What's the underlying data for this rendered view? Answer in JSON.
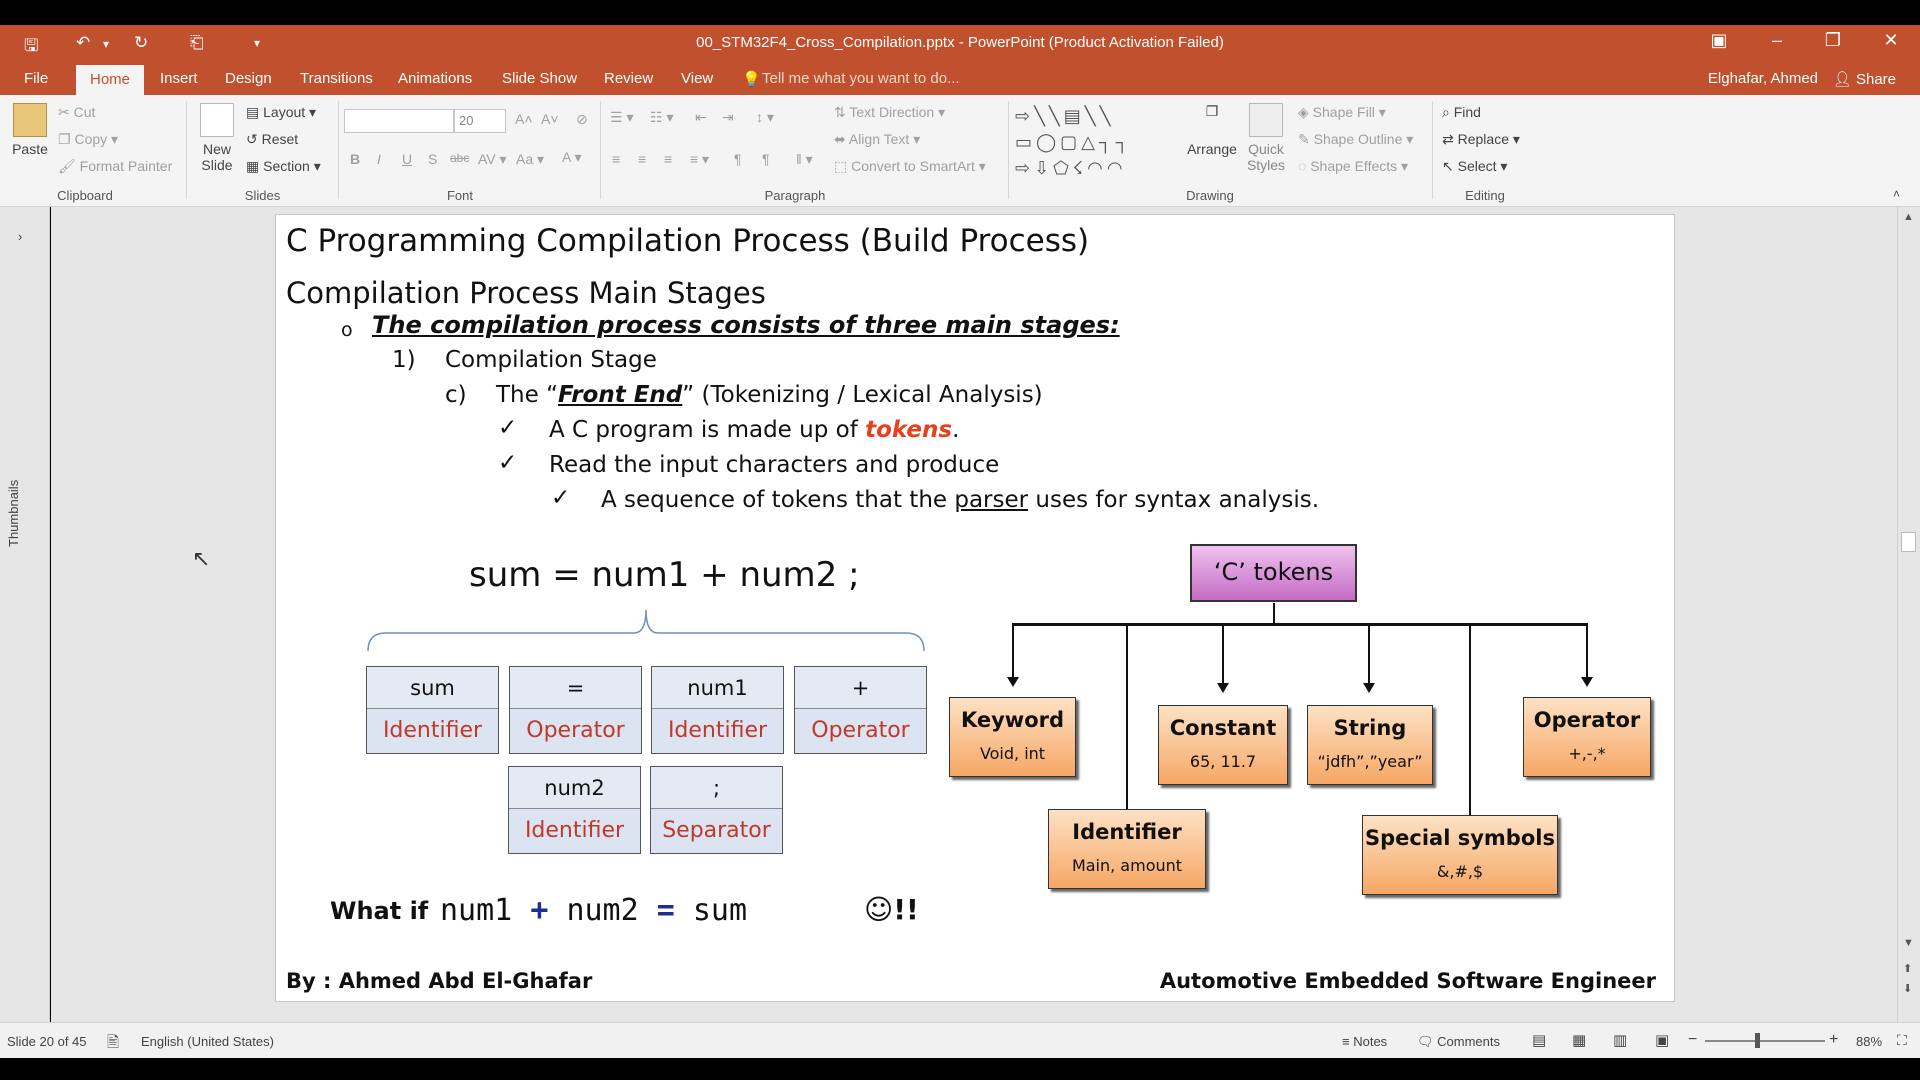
{
  "titlebar": {
    "title": "00_STM32F4_Cross_Compilation.pptx - PowerPoint (Product Activation Failed)",
    "save_icon": "save-icon",
    "undo_icon": "undo-icon",
    "redo_icon": "repeat-icon",
    "present_icon": "start-from-beginning-icon",
    "customize_glyph": "▾"
  },
  "tabs": [
    "File",
    "Home",
    "Insert",
    "Design",
    "Transitions",
    "Animations",
    "Slide Show",
    "Review",
    "View"
  ],
  "tell_me": "Tell me what you want to do...",
  "account": "Elghafar, Ahmed",
  "share": "Share",
  "ribbon": {
    "clipboard": {
      "label": "Clipboard",
      "paste": "Paste",
      "cut": "Cut",
      "copy": "Copy",
      "format_painter": "Format Painter"
    },
    "slides": {
      "label": "Slides",
      "new_slide_1": "New",
      "new_slide_2": "Slide",
      "layout": "Layout",
      "reset": "Reset",
      "section": "Section"
    },
    "font": {
      "label": "Font",
      "size": "20"
    },
    "paragraph": {
      "label": "Paragraph",
      "text_direction": "Text Direction",
      "align_text": "Align Text",
      "convert_smartart": "Convert to SmartArt"
    },
    "drawing": {
      "label": "Drawing",
      "arrange": "Arrange",
      "quick_styles_1": "Quick",
      "quick_styles_2": "Styles",
      "shape_fill": "Shape Fill",
      "shape_outline": "Shape Outline",
      "shape_effects": "Shape Effects"
    },
    "editing": {
      "label": "Editing",
      "find": "Find",
      "replace": "Replace",
      "select": "Select"
    }
  },
  "thumbnails_label": "Thumbnails",
  "slide": {
    "title": "C Programming Compilation Process (Build Process)",
    "subtitle": "Compilation Process Main Stages",
    "bullet_marker": "o",
    "lead": "The compilation process consists of three main stages:",
    "stage_num": "1)",
    "stage": "Compilation Stage",
    "sub_letter": "c)",
    "sub_pre": "The “",
    "sub_em": "Front End",
    "sub_post": "” (Tokenizing / Lexical Analysis)",
    "check": "✓",
    "item1_pre": "A C program is made up of ",
    "item1_em": "tokens",
    "item1_post": ".",
    "item2": "Read the input characters and produce",
    "item3_pre": "A sequence of tokens that the ",
    "item3_u": "parser",
    "item3_post": " uses for syntax analysis.",
    "expression": "sum = num1 + num2 ;",
    "token_boxes": [
      {
        "token": "sum",
        "kind": "Identifier"
      },
      {
        "token": "=",
        "kind": "Operator"
      },
      {
        "token": "num1",
        "kind": "Identifier"
      },
      {
        "token": "+",
        "kind": "Operator"
      },
      {
        "token": "num2",
        "kind": "Identifier"
      },
      {
        "token": ";",
        "kind": "Separator"
      }
    ],
    "whatif_label": "What if",
    "whatif_a": "num1",
    "whatif_plus": "+",
    "whatif_b": "num2",
    "whatif_eq": "=",
    "whatif_c": "sum",
    "whatif_smile": "☺!!",
    "tokens_root": "‘C’ tokens",
    "token_types": [
      {
        "name": "Keyword",
        "example": "Void, int"
      },
      {
        "name": "Identifier",
        "example": "Main, amount"
      },
      {
        "name": "Constant",
        "example": "65, 11.7"
      },
      {
        "name": "String",
        "example": "“jdfh”,”year”"
      },
      {
        "name": "Special symbols",
        "example": "&,#,$"
      },
      {
        "name": "Operator",
        "example": "+,-,*"
      }
    ],
    "footer_left": "By : Ahmed Abd El-Ghafar",
    "footer_right": "Automotive Embedded Software Engineer"
  },
  "status": {
    "slide": "Slide 20 of 45",
    "language": "English (United States)",
    "notes": "Notes",
    "comments": "Comments",
    "zoom": "88%"
  },
  "colors": {
    "accent": "#c1502e",
    "token_kind": "#c0392b",
    "tokens_em": "#e8401c",
    "root_box": "#c36cc4",
    "whatif_op": "#1f2f8f"
  }
}
